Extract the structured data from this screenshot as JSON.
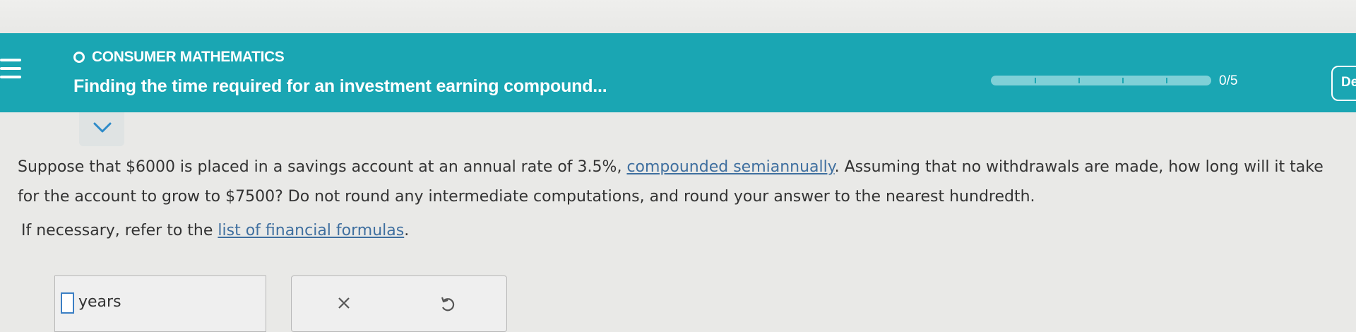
{
  "header": {
    "section": "CONSUMER MATHEMATICS",
    "title": "Finding the time required for an investment earning compound...",
    "progress_text": "0/5",
    "progress_fraction": 0,
    "corner_label": "De"
  },
  "question": {
    "part1": "Suppose that $6000 is placed in a savings account at an annual rate of 3.5%, ",
    "link": "compounded semiannually",
    "part2": ". Assuming that no withdrawals are made, how long will it take for the account to grow to $7500? Do not round any intermediate computations, and round your answer to the nearest hundredth."
  },
  "reference": {
    "prefix": "If necessary, refer to the ",
    "link": "list of financial formulas",
    "suffix": "."
  },
  "answer": {
    "unit": "years"
  },
  "icons": {
    "menu": "hamburger-icon",
    "section": "circle-icon",
    "expand": "chevron-down-icon",
    "clear": "x-icon",
    "undo": "undo-icon"
  },
  "colors": {
    "header": "#1aa6b3",
    "progress_track": "#7fd0d7",
    "link": "#3f6f9f",
    "cursor": "#3b7fc4"
  }
}
